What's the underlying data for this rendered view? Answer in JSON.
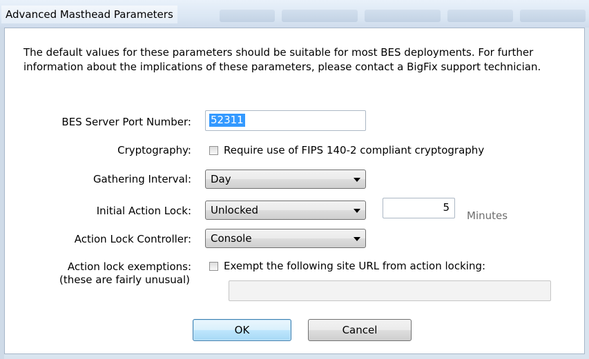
{
  "window": {
    "title": "Advanced Masthead Parameters"
  },
  "intro_text": "The default values for these parameters should be suitable for most BES deployments.  For further information about the implications of these parameters, please contact a BigFix support technician.",
  "fields": {
    "port": {
      "label": "BES Server Port Number:",
      "value": "52311"
    },
    "crypto": {
      "label": "Cryptography:",
      "checkbox_label": "Require use of FIPS 140-2 compliant cryptography",
      "checked": false
    },
    "gathering": {
      "label": "Gathering Interval:",
      "selected": "Day"
    },
    "initial_lock": {
      "label": "Initial Action Lock:",
      "selected": "Unlocked",
      "minutes_value": "5",
      "minutes_unit": "Minutes"
    },
    "lock_controller": {
      "label": "Action Lock Controller:",
      "selected": "Console"
    },
    "exemptions": {
      "label_line1": "Action lock exemptions:",
      "label_line2": "(these are fairly unusual)",
      "checkbox_label": "Exempt the following site URL from action locking:",
      "checked": false,
      "url_value": ""
    }
  },
  "buttons": {
    "ok": "OK",
    "cancel": "Cancel"
  },
  "colors": {
    "selection": "#3399ff",
    "default_button_border": "#3c7fb1"
  }
}
